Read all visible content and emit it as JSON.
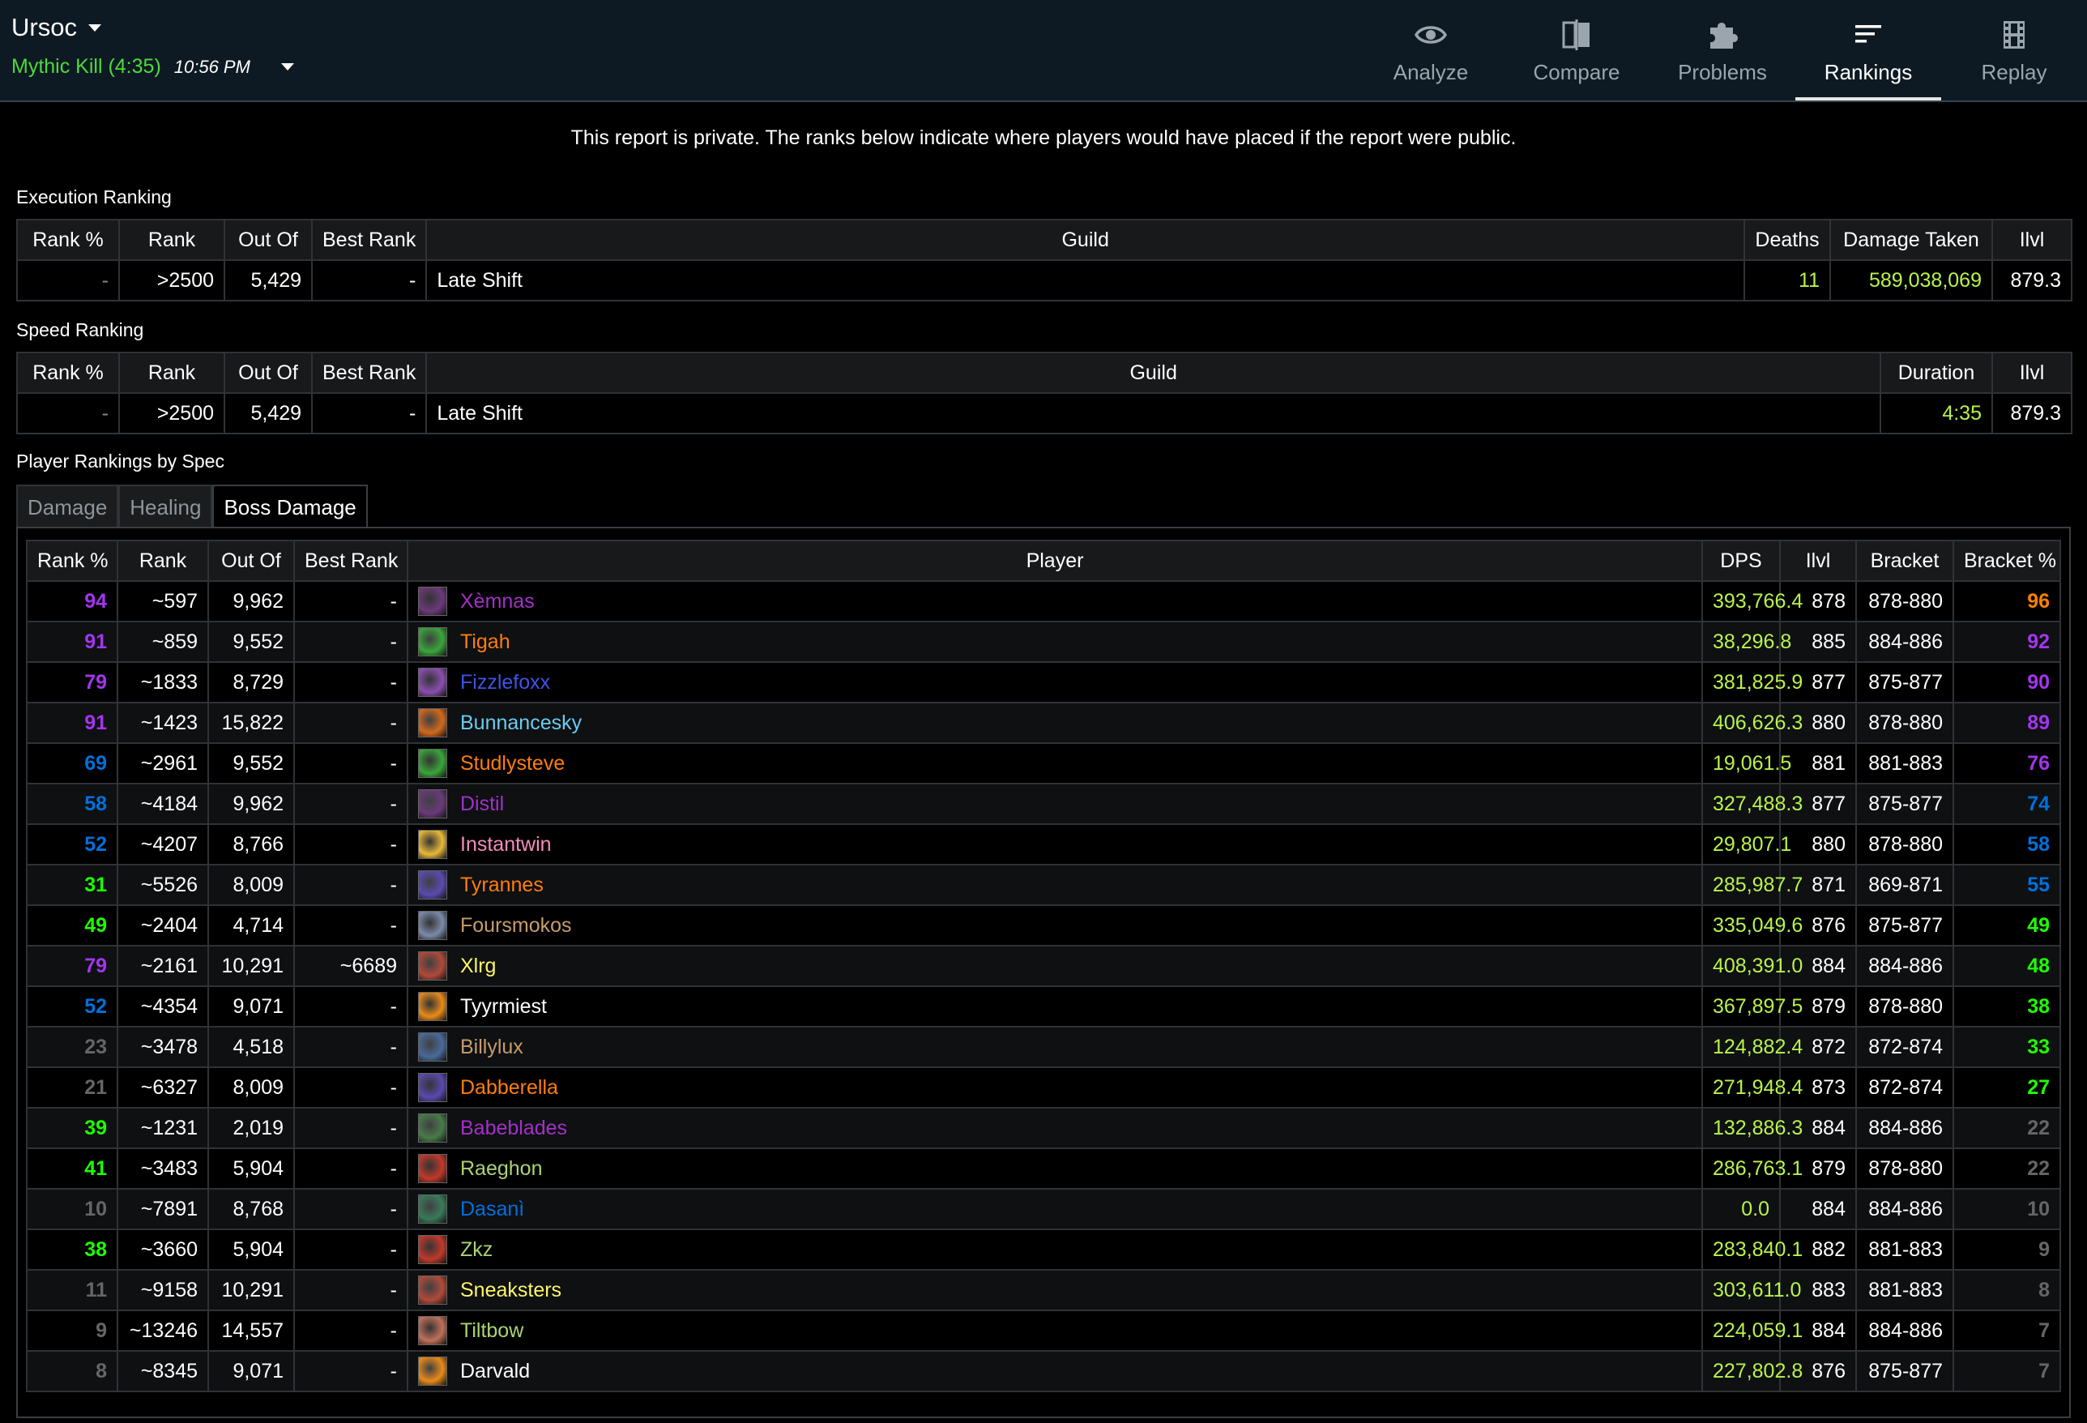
{
  "header": {
    "boss": "Ursoc",
    "fight_label": "Mythic Kill (4:35)",
    "fight_time": "10:56 PM",
    "nav": [
      {
        "label": "Analyze",
        "icon": "eye-icon"
      },
      {
        "label": "Compare",
        "icon": "compare-icon"
      },
      {
        "label": "Problems",
        "icon": "puzzle-icon"
      },
      {
        "label": "Rankings",
        "icon": "rankings-icon",
        "active": true
      },
      {
        "label": "Replay",
        "icon": "film-icon"
      }
    ]
  },
  "notice": "This report is private. The ranks below indicate where players would have placed if the report were public.",
  "execution": {
    "title": "Execution Ranking",
    "headers": [
      "Rank %",
      "Rank",
      "Out Of",
      "Best Rank",
      "Guild",
      "Deaths",
      "Damage Taken",
      "Ilvl"
    ],
    "row": [
      "-",
      ">2500",
      "5,429",
      "-",
      "Late Shift",
      "11",
      "589,038,069",
      "879.3"
    ]
  },
  "speed": {
    "title": "Speed Ranking",
    "headers": [
      "Rank %",
      "Rank",
      "Out Of",
      "Best Rank",
      "Guild",
      "Duration",
      "Ilvl"
    ],
    "row": [
      "-",
      ">2500",
      "5,429",
      "-",
      "Late Shift",
      "4:35",
      "879.3"
    ]
  },
  "players_section": {
    "title": "Player Rankings by Spec",
    "tabs": [
      {
        "label": "Damage",
        "active": false
      },
      {
        "label": "Healing",
        "active": false
      },
      {
        "label": "Boss Damage",
        "active": true
      }
    ],
    "headers": [
      "Rank %",
      "Rank",
      "Out Of",
      "Best Rank",
      "Player",
      "DPS",
      "Ilvl",
      "Bracket",
      "Bracket %"
    ]
  },
  "colors": {
    "legendary": "#ff8000",
    "epic": "#a335ee",
    "rare": "#0070dd",
    "uncommon": "#1eff00",
    "common": "#666666",
    "dps_green": "#b9f34b"
  },
  "players": [
    {
      "rank_pct": "94",
      "rank_color": "#a335ee",
      "rank": "~597",
      "out_of": "9,962",
      "best": "-",
      "name": "Xèmnas",
      "name_color": "#a330c9",
      "icon": "demon-hunter-spec-icon",
      "icon_color": "#6b3a7a",
      "dps": "393,766.4",
      "ilvl": "878",
      "bracket": "878-880",
      "bracket_pct": "96",
      "bp_color": "#ff8000"
    },
    {
      "rank_pct": "91",
      "rank_color": "#a335ee",
      "rank": "~859",
      "out_of": "9,552",
      "best": "-",
      "name": "Tigah",
      "name_color": "#ff7d0a",
      "icon": "druid-feral-spec-icon",
      "icon_color": "#3aa53a",
      "dps": "38,296.8",
      "ilvl": "885",
      "bracket": "884-886",
      "bracket_pct": "92",
      "bp_color": "#a335ee"
    },
    {
      "rank_pct": "79",
      "rank_color": "#a335ee",
      "rank": "~1833",
      "out_of": "8,729",
      "best": "-",
      "name": "Fizzlefoxx",
      "name_color": "#3c55e6",
      "icon": "shaman-spec-icon",
      "icon_color": "#8a4fb0",
      "dps": "381,825.9",
      "ilvl": "877",
      "bracket": "875-877",
      "bracket_pct": "90",
      "bp_color": "#a335ee"
    },
    {
      "rank_pct": "91",
      "rank_color": "#a335ee",
      "rank": "~1423",
      "out_of": "15,822",
      "best": "-",
      "name": "Bunnancesky",
      "name_color": "#69ccf0",
      "icon": "mage-fire-spec-icon",
      "icon_color": "#d2691e",
      "dps": "406,626.3",
      "ilvl": "880",
      "bracket": "878-880",
      "bracket_pct": "89",
      "bp_color": "#a335ee"
    },
    {
      "rank_pct": "69",
      "rank_color": "#0070dd",
      "rank": "~2961",
      "out_of": "9,552",
      "best": "-",
      "name": "Studlysteve",
      "name_color": "#ff7d0a",
      "icon": "druid-feral-spec-icon",
      "icon_color": "#3aa53a",
      "dps": "19,061.5",
      "ilvl": "881",
      "bracket": "881-883",
      "bracket_pct": "76",
      "bp_color": "#a335ee"
    },
    {
      "rank_pct": "58",
      "rank_color": "#0070dd",
      "rank": "~4184",
      "out_of": "9,962",
      "best": "-",
      "name": "Distil",
      "name_color": "#a330c9",
      "icon": "demon-hunter-spec-icon",
      "icon_color": "#6b3a7a",
      "dps": "327,488.3",
      "ilvl": "877",
      "bracket": "875-877",
      "bracket_pct": "74",
      "bp_color": "#0070dd"
    },
    {
      "rank_pct": "52",
      "rank_color": "#0070dd",
      "rank": "~4207",
      "out_of": "8,766",
      "best": "-",
      "name": "Instantwin",
      "name_color": "#f58cba",
      "icon": "paladin-retribution-spec-icon",
      "icon_color": "#e8b83a",
      "dps": "29,807.1",
      "ilvl": "880",
      "bracket": "878-880",
      "bracket_pct": "58",
      "bp_color": "#0070dd"
    },
    {
      "rank_pct": "31",
      "rank_color": "#1eff00",
      "rank": "~5526",
      "out_of": "8,009",
      "best": "-",
      "name": "Tyrannes",
      "name_color": "#ff7d0a",
      "icon": "druid-balance-spec-icon",
      "icon_color": "#5a4ab0",
      "dps": "285,987.7",
      "ilvl": "871",
      "bracket": "869-871",
      "bracket_pct": "55",
      "bp_color": "#0070dd"
    },
    {
      "rank_pct": "49",
      "rank_color": "#1eff00",
      "rank": "~2404",
      "out_of": "4,714",
      "best": "-",
      "name": "Foursmokos",
      "name_color": "#c79c6e",
      "icon": "warrior-spec-icon",
      "icon_color": "#7a8aa8",
      "dps": "335,049.6",
      "ilvl": "876",
      "bracket": "875-877",
      "bracket_pct": "49",
      "bp_color": "#1eff00"
    },
    {
      "rank_pct": "79",
      "rank_color": "#a335ee",
      "rank": "~2161",
      "out_of": "10,291",
      "best": "~6689",
      "name": "Xlrg",
      "name_color": "#fff569",
      "icon": "rogue-spec-icon",
      "icon_color": "#b04a3a",
      "dps": "408,391.0",
      "ilvl": "884",
      "bracket": "884-886",
      "bracket_pct": "48",
      "bp_color": "#1eff00"
    },
    {
      "rank_pct": "52",
      "rank_color": "#0070dd",
      "rank": "~4354",
      "out_of": "9,071",
      "best": "-",
      "name": "Tyyrmiest",
      "name_color": "#ffffff",
      "icon": "priest-shadow-spec-icon",
      "icon_color": "#e88a1a",
      "dps": "367,897.5",
      "ilvl": "879",
      "bracket": "878-880",
      "bracket_pct": "38",
      "bp_color": "#1eff00"
    },
    {
      "rank_pct": "23",
      "rank_color": "#666666",
      "rank": "~3478",
      "out_of": "4,518",
      "best": "-",
      "name": "Billylux",
      "name_color": "#c79c6e",
      "icon": "warrior-protection-spec-icon",
      "icon_color": "#4a6a9a",
      "dps": "124,882.4",
      "ilvl": "872",
      "bracket": "872-874",
      "bracket_pct": "33",
      "bp_color": "#1eff00"
    },
    {
      "rank_pct": "21",
      "rank_color": "#666666",
      "rank": "~6327",
      "out_of": "8,009",
      "best": "-",
      "name": "Dabberella",
      "name_color": "#ff7d0a",
      "icon": "druid-balance-spec-icon",
      "icon_color": "#5a4ab0",
      "dps": "271,948.4",
      "ilvl": "873",
      "bracket": "872-874",
      "bracket_pct": "27",
      "bp_color": "#1eff00"
    },
    {
      "rank_pct": "39",
      "rank_color": "#1eff00",
      "rank": "~1231",
      "out_of": "2,019",
      "best": "-",
      "name": "Babeblades",
      "name_color": "#a330c9",
      "icon": "demon-hunter-vengeance-spec-icon",
      "icon_color": "#4a7a4a",
      "dps": "132,886.3",
      "ilvl": "884",
      "bracket": "884-886",
      "bracket_pct": "22",
      "bp_color": "#666666"
    },
    {
      "rank_pct": "41",
      "rank_color": "#1eff00",
      "rank": "~3483",
      "out_of": "5,904",
      "best": "-",
      "name": "Raeghon",
      "name_color": "#abd473",
      "icon": "hunter-spec-icon",
      "icon_color": "#c0392b",
      "dps": "286,763.1",
      "ilvl": "879",
      "bracket": "878-880",
      "bracket_pct": "22",
      "bp_color": "#666666"
    },
    {
      "rank_pct": "10",
      "rank_color": "#666666",
      "rank": "~7891",
      "out_of": "8,768",
      "best": "-",
      "name": "Dasanì",
      "name_color": "#0070de",
      "icon": "shaman-enhancement-spec-icon",
      "icon_color": "#3a7a5a",
      "dps": "0.0",
      "ilvl": "884",
      "bracket": "884-886",
      "bracket_pct": "10",
      "bp_color": "#666666"
    },
    {
      "rank_pct": "38",
      "rank_color": "#1eff00",
      "rank": "~3660",
      "out_of": "5,904",
      "best": "-",
      "name": "Zkz",
      "name_color": "#abd473",
      "icon": "hunter-spec-icon",
      "icon_color": "#c0392b",
      "dps": "283,840.1",
      "ilvl": "882",
      "bracket": "881-883",
      "bracket_pct": "9",
      "bp_color": "#666666"
    },
    {
      "rank_pct": "11",
      "rank_color": "#666666",
      "rank": "~9158",
      "out_of": "10,291",
      "best": "-",
      "name": "Sneaksters",
      "name_color": "#fff569",
      "icon": "rogue-spec-icon",
      "icon_color": "#b04a3a",
      "dps": "303,611.0",
      "ilvl": "883",
      "bracket": "881-883",
      "bracket_pct": "8",
      "bp_color": "#666666"
    },
    {
      "rank_pct": "9",
      "rank_color": "#666666",
      "rank": "~13246",
      "out_of": "14,557",
      "best": "-",
      "name": "Tiltbow",
      "name_color": "#abd473",
      "icon": "hunter-marksman-spec-icon",
      "icon_color": "#c0705a",
      "dps": "224,059.1",
      "ilvl": "884",
      "bracket": "884-886",
      "bracket_pct": "7",
      "bp_color": "#666666"
    },
    {
      "rank_pct": "8",
      "rank_color": "#666666",
      "rank": "~8345",
      "out_of": "9,071",
      "best": "-",
      "name": "Darvald",
      "name_color": "#ffffff",
      "icon": "priest-shadow-spec-icon",
      "icon_color": "#e88a1a",
      "dps": "227,802.8",
      "ilvl": "876",
      "bracket": "875-877",
      "bracket_pct": "7",
      "bp_color": "#666666"
    }
  ]
}
